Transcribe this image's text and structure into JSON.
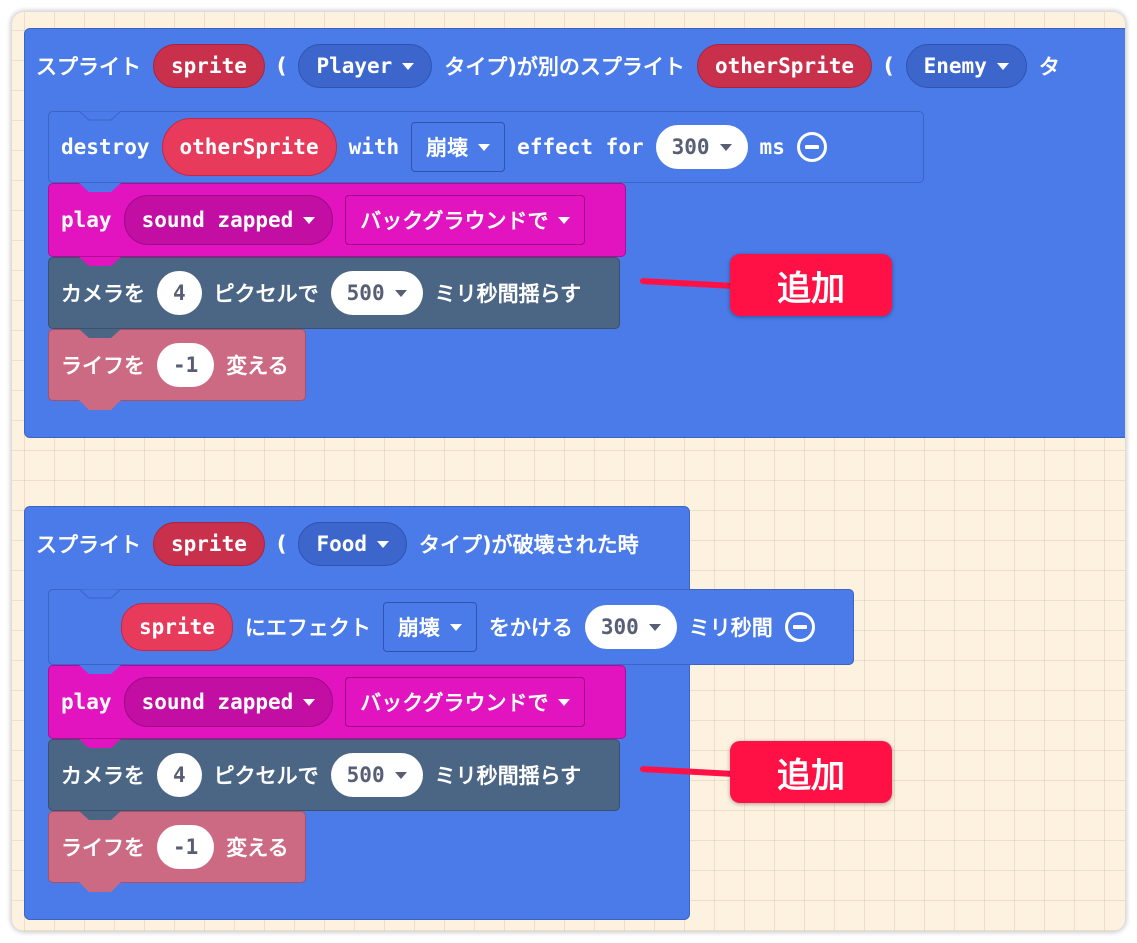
{
  "colors": {
    "canvas_bg": "#fdf1e0",
    "event_blue": "#4a7be8",
    "sprite_var": "#c8304c",
    "music_pink": "#e114c0",
    "scene_slate": "#4b6584",
    "info_rose": "#cc6983",
    "annotation_red": "#ff1146"
  },
  "blocks": [
    {
      "event": {
        "prefix": "スプライト",
        "var": "sprite",
        "open_paren": "(",
        "kind": "Player",
        "middle": "タイプ)が別のスプライト",
        "other_var": "otherSprite",
        "open_paren2": "(",
        "other_kind": "Enemy",
        "suffix": "タ"
      },
      "destroy": {
        "label": "destroy",
        "target": "otherSprite",
        "with_label": "with",
        "effect": "崩壊",
        "effect_for_label": "effect for",
        "duration": "300",
        "unit": "ms",
        "remove_icon": "minus-circle-icon"
      },
      "play": {
        "label": "play",
        "sound": "sound zapped",
        "mode": "バックグラウンドで"
      },
      "shake": {
        "prefix": "カメラを",
        "pixels": "4",
        "middle": "ピクセルで",
        "duration": "500",
        "suffix": "ミリ秒間揺らす"
      },
      "life": {
        "prefix": "ライフを",
        "amount": "-1",
        "suffix": "変える"
      },
      "annotation": "追加"
    },
    {
      "event": {
        "prefix": "スプライト",
        "var": "sprite",
        "open_paren": "(",
        "kind": "Food",
        "suffix": "タイプ)が破壊された時"
      },
      "destroy": {
        "target": "sprite",
        "mid_label": "にエフェクト",
        "effect": "崩壊",
        "apply_label": "をかける",
        "duration": "300",
        "unit": "ミリ秒間",
        "remove_icon": "minus-circle-icon"
      },
      "play": {
        "label": "play",
        "sound": "sound zapped",
        "mode": "バックグラウンドで"
      },
      "shake": {
        "prefix": "カメラを",
        "pixels": "4",
        "middle": "ピクセルで",
        "duration": "500",
        "suffix": "ミリ秒間揺らす"
      },
      "life": {
        "prefix": "ライフを",
        "amount": "-1",
        "suffix": "変える"
      },
      "annotation": "追加"
    }
  ]
}
